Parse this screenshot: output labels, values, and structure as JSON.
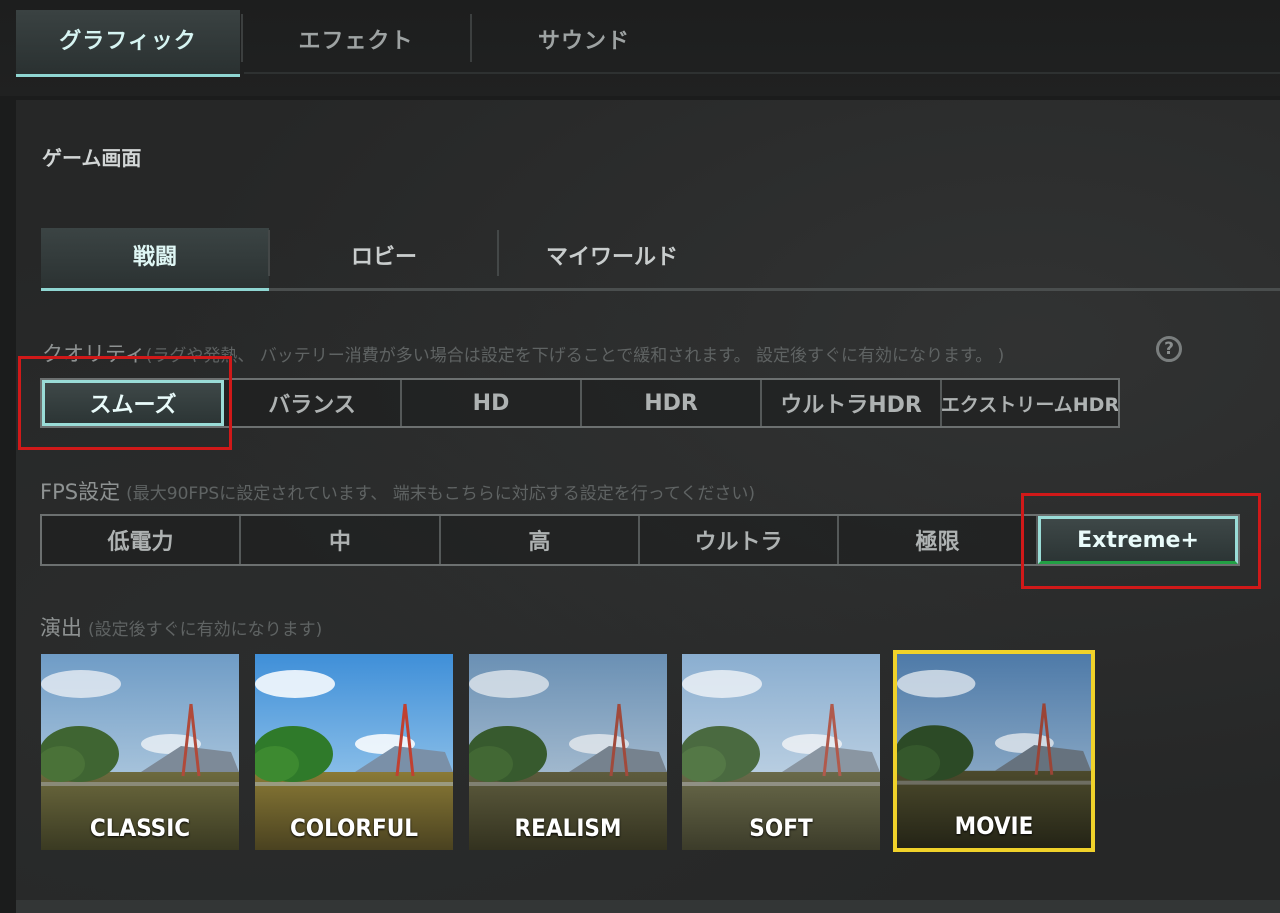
{
  "top_tabs": [
    {
      "label": "グラフィック",
      "active": true
    },
    {
      "label": "エフェクト",
      "active": false
    },
    {
      "label": "サウンド",
      "active": false
    }
  ],
  "section_title": "ゲーム画面",
  "sub_tabs": [
    {
      "label": "戦闘",
      "active": true
    },
    {
      "label": "ロビー",
      "active": false
    },
    {
      "label": "マイワールド",
      "active": false
    }
  ],
  "quality": {
    "label": "クオリティ",
    "note": "(ラグや発熱、 バッテリー消費が多い場合は設定を下げることで緩和されます。 設定後すぐに有効になります。 )",
    "help_icon": "?",
    "options": [
      "スムーズ",
      "バランス",
      "HD",
      "HDR",
      "ウルトラHDR",
      "エクストリームHDR"
    ],
    "selected": "スムーズ"
  },
  "fps": {
    "label": "FPS設定",
    "note": "(最大90FPSに設定されています、 端末もこちらに対応する設定を行ってください)",
    "options": [
      "低電力",
      "中",
      "高",
      "ウルトラ",
      "極限",
      "Extreme+"
    ],
    "selected": "Extreme+"
  },
  "style": {
    "label": "演出",
    "note": "(設定後すぐに有効になります)",
    "options": [
      {
        "label": "CLASSIC",
        "selected": false
      },
      {
        "label": "COLORFUL",
        "selected": false
      },
      {
        "label": "REALISM",
        "selected": false
      },
      {
        "label": "SOFT",
        "selected": false
      },
      {
        "label": "MOVIE",
        "selected": true
      }
    ]
  },
  "colors": {
    "accent_teal": "#9adcd7",
    "highlight_red": "#d01919",
    "selected_yellow": "#f0d22a"
  }
}
